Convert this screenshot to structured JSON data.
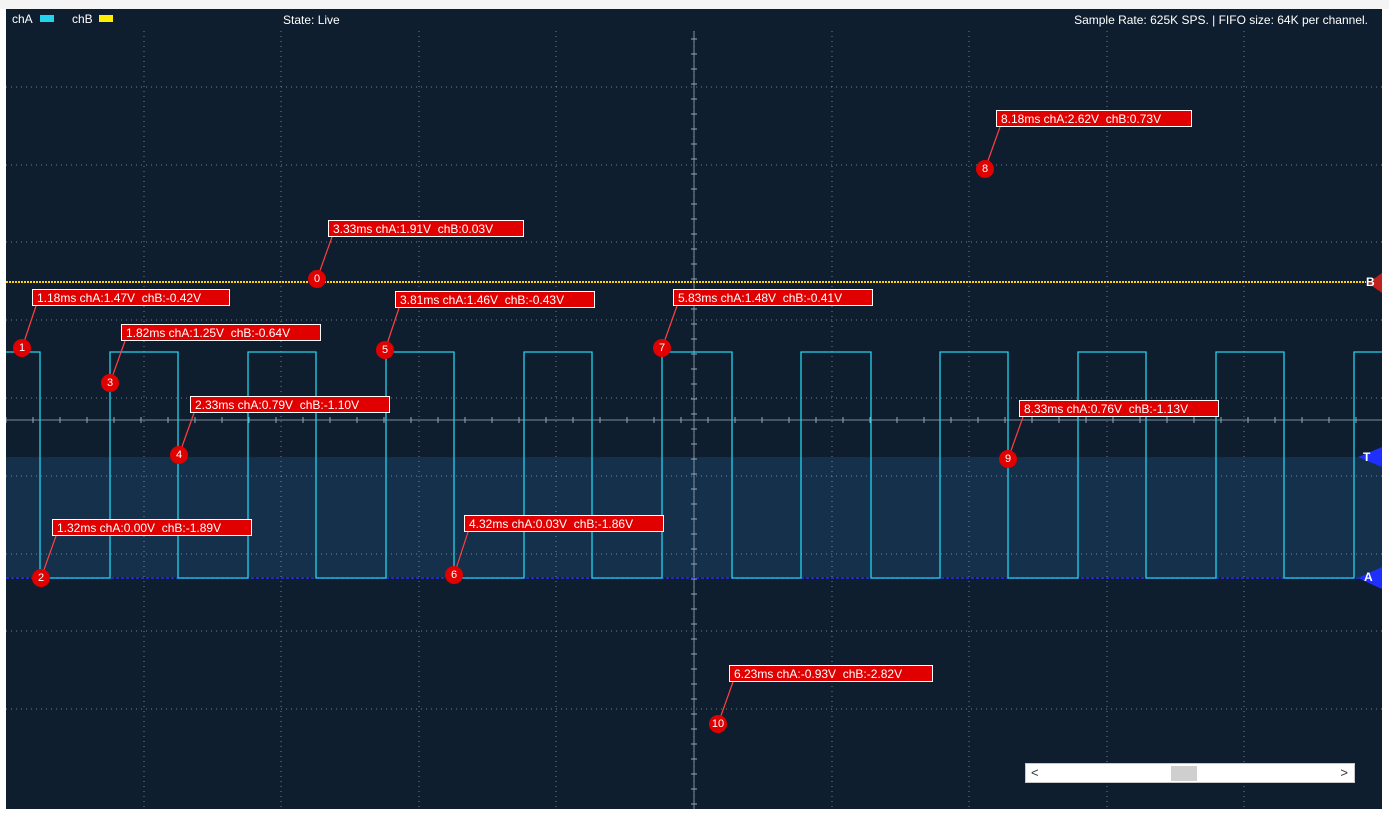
{
  "legend": [
    {
      "label": "chA",
      "color": "#22d3ee"
    },
    {
      "label": "chB",
      "color": "#ffee00"
    }
  ],
  "state": "State: Live",
  "status_info": "Sample Rate: 625K SPS. | FIFO size: 64K per channel.",
  "channel_markers": {
    "b": "B",
    "t": "T",
    "a": "A"
  },
  "annotations": [
    {
      "id": "0",
      "text": "3.33ms chA:1.91V  chB:0.03V"
    },
    {
      "id": "1",
      "text": "1.18ms chA:1.47V  chB:-0.42V"
    },
    {
      "id": "2",
      "text": "1.32ms chA:0.00V  chB:-1.89V"
    },
    {
      "id": "3",
      "text": "1.82ms chA:1.25V  chB:-0.64V"
    },
    {
      "id": "4",
      "text": "2.33ms chA:0.79V  chB:-1.10V"
    },
    {
      "id": "5",
      "text": "3.81ms chA:1.46V  chB:-0.43V"
    },
    {
      "id": "6",
      "text": "4.32ms chA:0.03V  chB:-1.86V"
    },
    {
      "id": "7",
      "text": "5.83ms chA:1.48V  chB:-0.41V"
    },
    {
      "id": "8",
      "text": "8.18ms chA:2.62V  chB:0.73V"
    },
    {
      "id": "9",
      "text": "8.33ms chA:0.76V  chB:-1.13V"
    },
    {
      "id": "10",
      "text": "6.23ms chA:-0.93V  chB:-2.82V"
    }
  ],
  "scrollbar": {
    "left_arrow": "<",
    "right_arrow": ">"
  },
  "colors": {
    "background": "#0f1e2e",
    "grid": "#9aa8b4",
    "chA": "#22d3ee",
    "chB": "#ffd400",
    "marker": "#e00000",
    "trigger_band": "#14304a",
    "ground": "#2b2bff"
  }
}
